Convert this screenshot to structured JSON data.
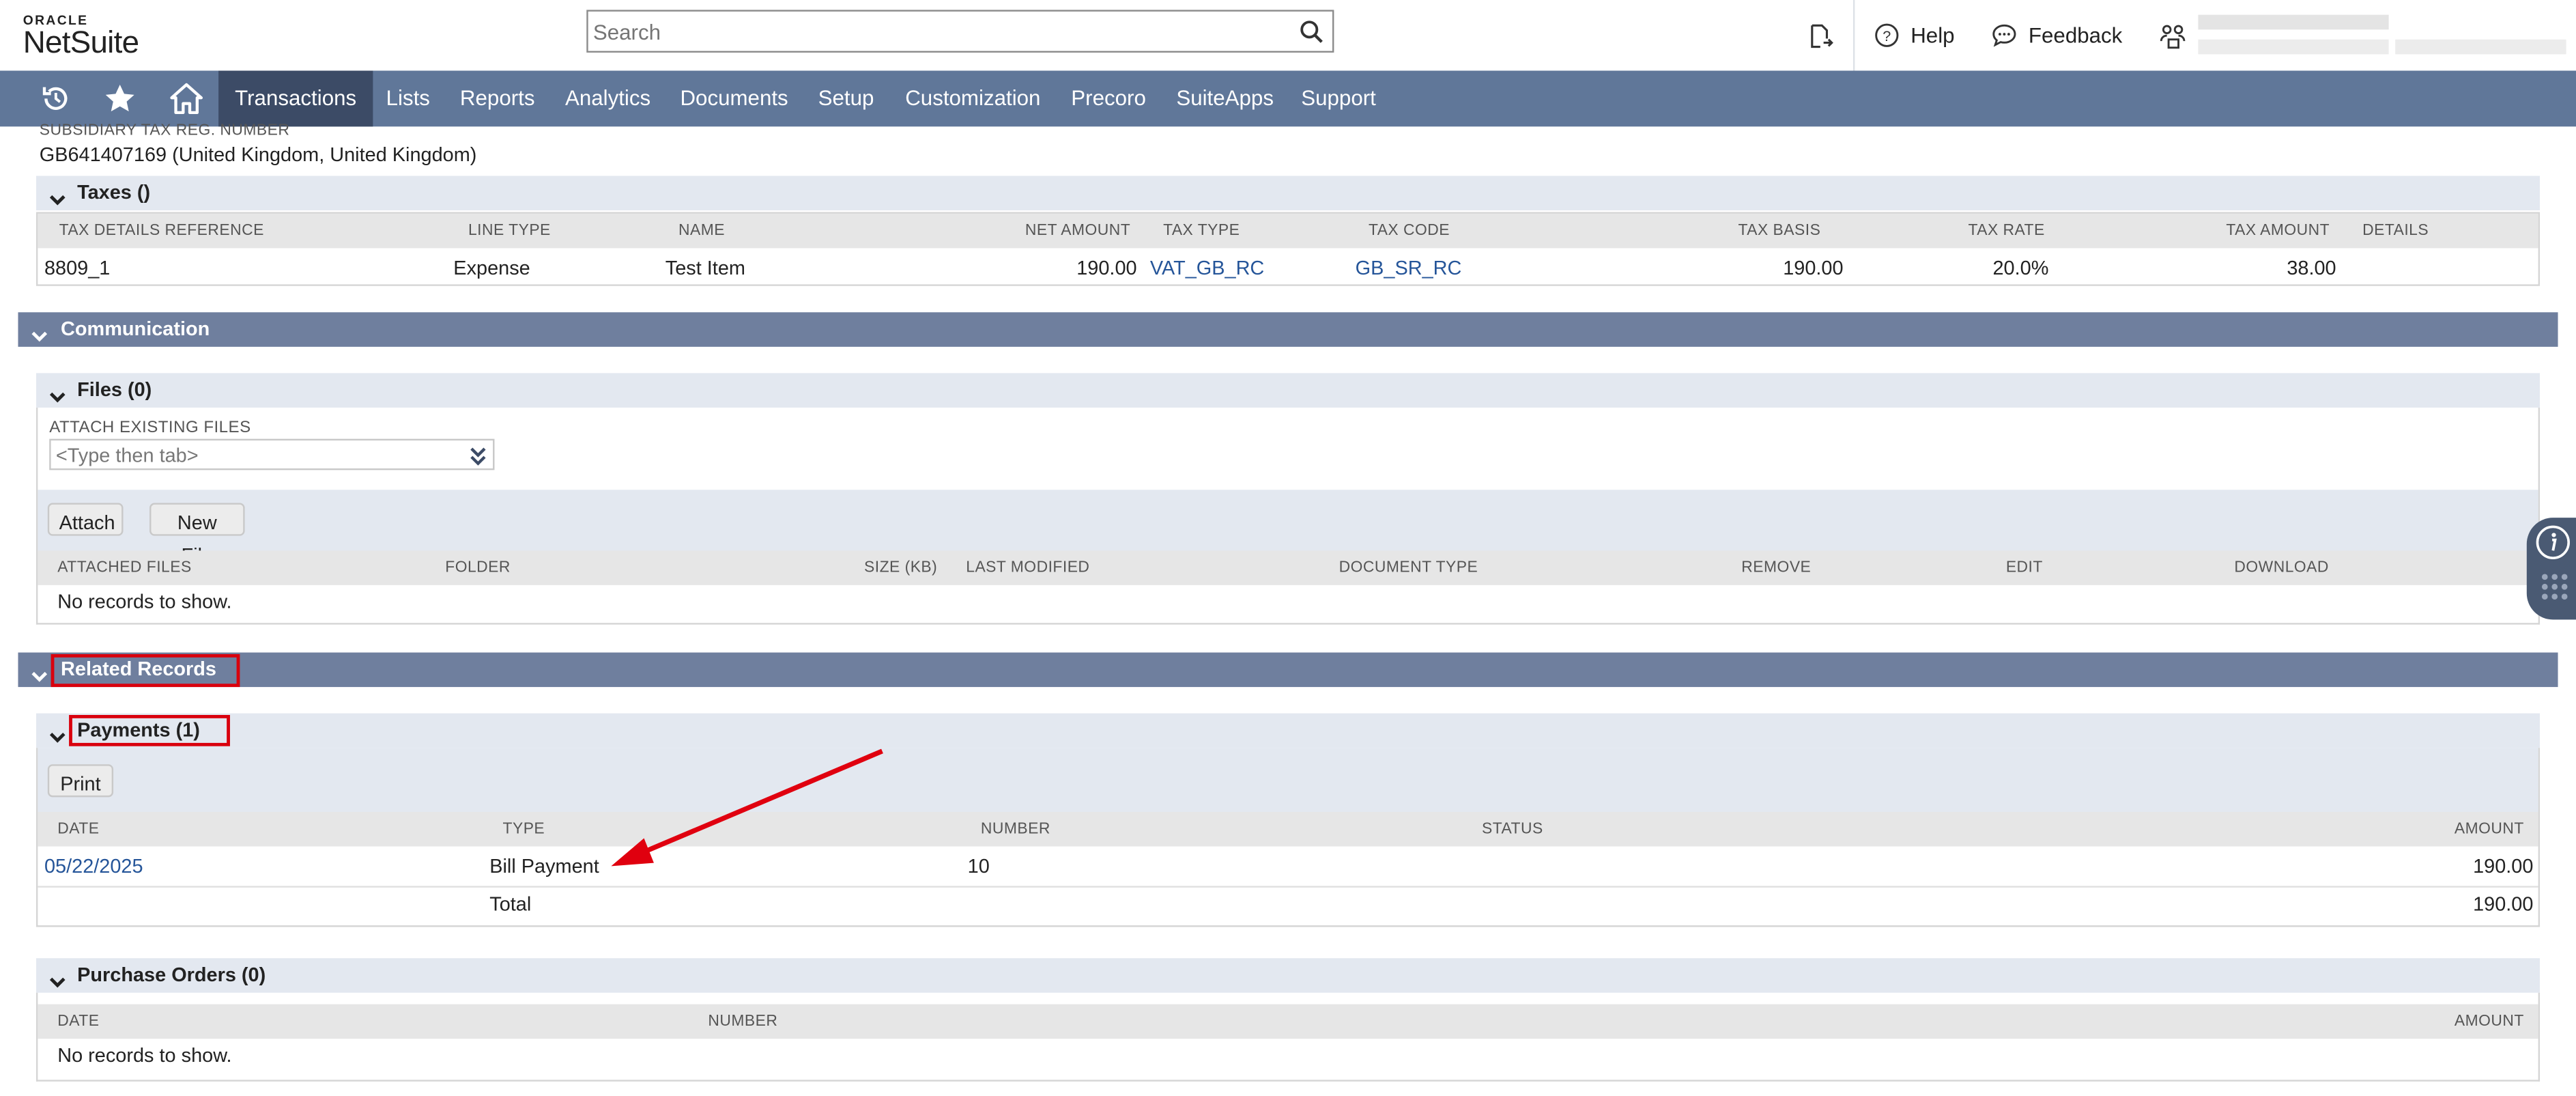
{
  "header": {
    "logo_top": "ORACLE",
    "logo_main": "NetSuite",
    "search_placeholder": "Search",
    "help_label": "Help",
    "feedback_label": "Feedback"
  },
  "nav": {
    "icons": [
      "recent-icon",
      "star-icon",
      "home-icon"
    ],
    "items": [
      "Transactions",
      "Lists",
      "Reports",
      "Analytics",
      "Documents",
      "Setup",
      "Customization",
      "Precoro",
      "SuiteApps",
      "Support"
    ],
    "active": "Transactions"
  },
  "subsidiary": {
    "label": "SUBSIDIARY TAX REG. NUMBER",
    "value": "GB641407169 (United Kingdom, United Kingdom)"
  },
  "taxes": {
    "title": "Taxes ()",
    "columns": [
      "TAX DETAILS REFERENCE",
      "LINE TYPE",
      "NAME",
      "NET AMOUNT",
      "TAX TYPE",
      "TAX CODE",
      "TAX BASIS",
      "TAX RATE",
      "TAX AMOUNT",
      "DETAILS"
    ],
    "rows": [
      {
        "ref": "8809_1",
        "line_type": "Expense",
        "name": "Test Item",
        "net_amount": "190.00",
        "tax_type": "VAT_GB_RC",
        "tax_code": "GB_SR_RC",
        "tax_basis": "190.00",
        "tax_rate": "20.0%",
        "tax_amount": "38.00",
        "details": ""
      }
    ]
  },
  "communication": {
    "title": "Communication",
    "files": {
      "title": "Files (0)",
      "attach_label": "ATTACH EXISTING FILES",
      "attach_placeholder": "<Type then tab>",
      "attach_button": "Attach",
      "new_file_button": "New File",
      "columns": [
        "ATTACHED FILES",
        "FOLDER",
        "SIZE (KB)",
        "LAST MODIFIED",
        "DOCUMENT TYPE",
        "REMOVE",
        "EDIT",
        "DOWNLOAD"
      ],
      "empty": "No records to show."
    }
  },
  "related": {
    "title": "Related Records",
    "payments": {
      "title": "Payments (1)",
      "print_button": "Print",
      "columns": [
        "DATE",
        "TYPE",
        "NUMBER",
        "STATUS",
        "AMOUNT"
      ],
      "rows": [
        {
          "date": "05/22/2025",
          "type": "Bill Payment",
          "number": "10",
          "status": "",
          "amount": "190.00"
        }
      ],
      "total_label": "Total",
      "total_amount": "190.00"
    },
    "purchase_orders": {
      "title": "Purchase Orders (0)",
      "columns": [
        "DATE",
        "NUMBER",
        "AMOUNT"
      ],
      "empty": "No records to show."
    }
  },
  "colors": {
    "nav_bg": "#607799",
    "nav_active": "#3c4b66",
    "section_bg": "#6f7f9e",
    "subsection_bg": "#e3e8f0",
    "link": "#255599",
    "highlight_red": "#d9000d"
  }
}
